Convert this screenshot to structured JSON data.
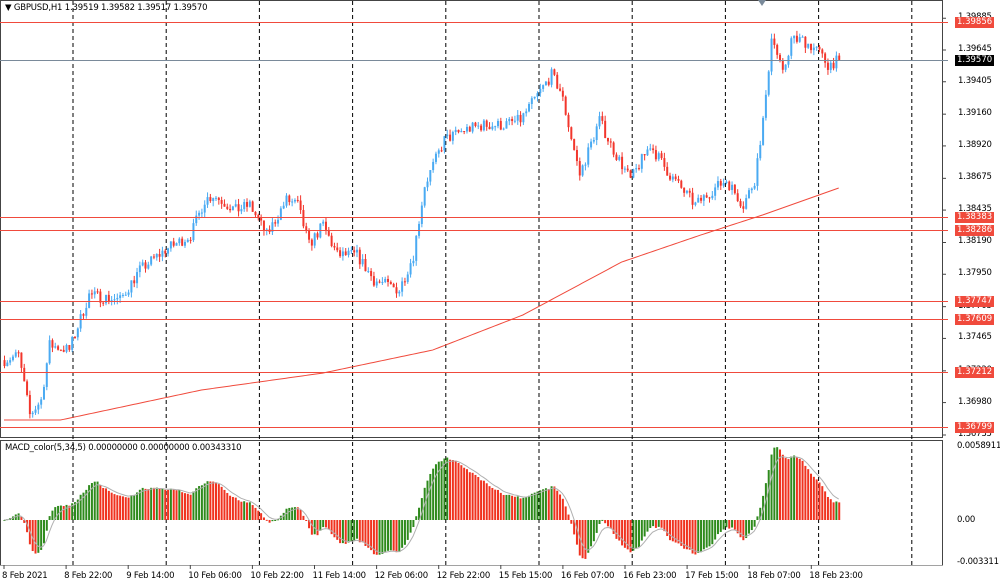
{
  "header": {
    "symbol": "GBPUSD,H1",
    "ohlc": "1.39519 1.39582 1.39517 1.39570"
  },
  "macd_header": "MACD_color(5,34,5) 0.00000000 0.00000000 0.00343310",
  "colors": {
    "bull": "#4aaaf2",
    "bear": "#f2362c",
    "level": "#f04a3c",
    "ma": "#f04a3c",
    "macd_up": "#2e8a1c",
    "macd_down": "#f0321f",
    "signal": "#b0b0b0",
    "price_line": "#7a8a9a"
  },
  "chart_data": {
    "type": "candlestick",
    "symbol": "GBPUSD",
    "timeframe": "H1",
    "ylim": [
      1.3667,
      1.3995
    ],
    "y_ticks": [
      "1.39885",
      "1.39645",
      "1.39405",
      "1.39160",
      "1.38920",
      "1.38675",
      "1.38435",
      "1.38190",
      "1.37950",
      "1.37705",
      "1.37465",
      "1.37220",
      "1.36980",
      "1.36735"
    ],
    "x_ticks": [
      "8 Feb 2021",
      "8 Feb 22:00",
      "9 Feb 14:00",
      "10 Feb 06:00",
      "10 Feb 22:00",
      "11 Feb 14:00",
      "12 Feb 06:00",
      "12 Feb 22:00",
      "15 Feb 15:00",
      "16 Feb 07:00",
      "16 Feb 23:00",
      "17 Feb 15:00",
      "18 Feb 07:00",
      "18 Feb 23:00"
    ],
    "price_path_hours": [
      0,
      5,
      9,
      13,
      16,
      23,
      30,
      41,
      48,
      57,
      66,
      71,
      74,
      82,
      87,
      93,
      100,
      104,
      108,
      113,
      118,
      125,
      131,
      140,
      145,
      149,
      156,
      163,
      170,
      177,
      183,
      194,
      197,
      198,
      204,
      211,
      215,
      222,
      229,
      236,
      245,
      251,
      256,
      262,
      266,
      270,
      272,
      276,
      279,
      283,
      288,
      292,
      296
    ],
    "price_path": [
      1.37301,
      1.37339,
      1.36886,
      1.36999,
      1.37415,
      1.37377,
      1.37793,
      1.37755,
      1.37982,
      1.38133,
      1.38246,
      1.38511,
      1.38549,
      1.38435,
      1.38473,
      1.38246,
      1.38511,
      1.38473,
      1.38171,
      1.38322,
      1.38095,
      1.38095,
      1.37906,
      1.37831,
      1.38095,
      1.38624,
      1.38965,
      1.3904,
      1.39078,
      1.39078,
      1.39116,
      1.39456,
      1.39343,
      1.39267,
      1.387,
      1.39116,
      1.38927,
      1.38662,
      1.38927,
      1.387,
      1.38473,
      1.38587,
      1.38662,
      1.38473,
      1.38662,
      1.39267,
      1.39758,
      1.39456,
      1.39721,
      1.39721,
      1.39645,
      1.39532,
      1.3957
    ],
    "ma_hours": [
      0,
      20,
      70,
      113,
      152,
      184,
      219,
      247,
      269,
      296
    ],
    "ma_values": [
      1.36848,
      1.36848,
      1.37075,
      1.37203,
      1.37377,
      1.37642,
      1.38042,
      1.38246,
      1.38398,
      1.38602
    ],
    "levels": [
      "1.39856",
      "1.38383",
      "1.38286",
      "1.37747",
      "1.37609",
      "1.37212",
      "1.36799"
    ],
    "current_price": "1.39570",
    "macd": {
      "fast": 5,
      "slow": 34,
      "signal": 5,
      "y_ticks": [
        "0.0058911",
        "0.00",
        "-0.003311"
      ],
      "ylim": [
        -0.0033119,
        0.0058911
      ]
    }
  }
}
